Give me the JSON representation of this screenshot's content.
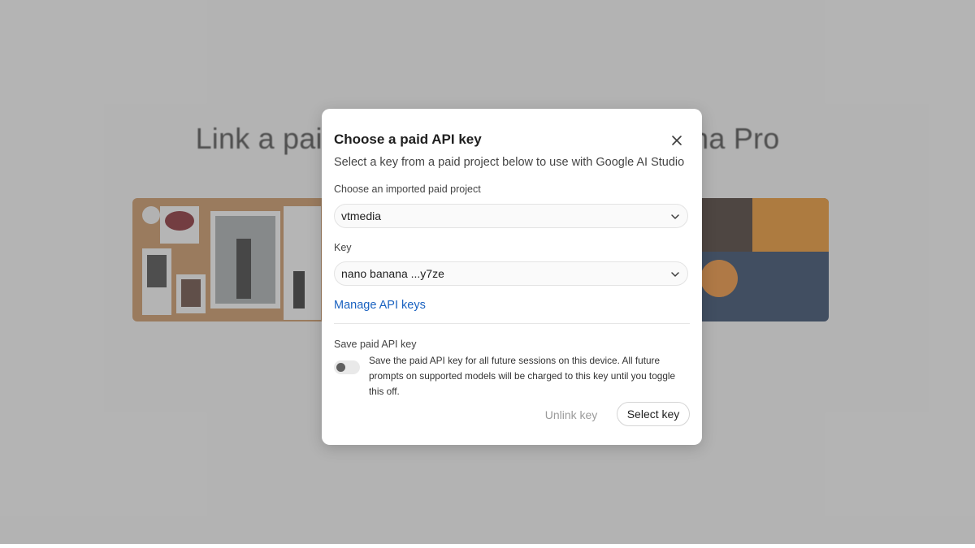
{
  "background": {
    "title": "Link a paid API key to use Nano Banana Pro"
  },
  "dialog": {
    "title": "Choose a paid API key",
    "subtitle": "Select a key from a paid project below to use with Google AI Studio",
    "project_label": "Choose an imported paid project",
    "project_value": "vtmedia",
    "key_label": "Key",
    "key_value": "nano banana ...y7ze",
    "manage_link": "Manage API keys",
    "save_label": "Save paid API key",
    "save_description": "Save the paid API key for all future sessions on this device. All future prompts on supported models will be charged to this key until you toggle this off.",
    "toggle_on": false,
    "unlink_button": "Unlink key",
    "select_button": "Select key"
  },
  "colors": {
    "link": "#1a62c0",
    "dim_overlay": "#696969"
  },
  "icons": {
    "close": "close-icon",
    "chevron": "chevron-down-icon"
  }
}
